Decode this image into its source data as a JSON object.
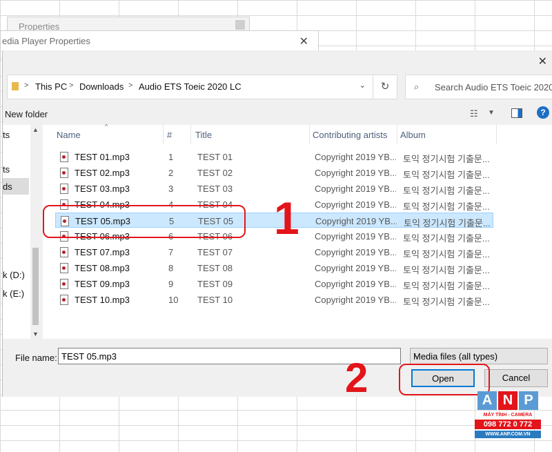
{
  "bg_windows": {
    "properties_title": "Properties",
    "media_title": "edia Player Properties"
  },
  "address": {
    "crumbs": [
      "This PC",
      "Downloads",
      "Audio ETS Toeic 2020 LC"
    ]
  },
  "search": {
    "placeholder": "Search Audio ETS Toeic 2020..."
  },
  "toolbar": {
    "new_folder": "New folder"
  },
  "nav": {
    "items": [
      "ts",
      "ts",
      "ds",
      "k (D:)",
      "k (E:)"
    ]
  },
  "columns": {
    "name": "Name",
    "number": "#",
    "title": "Title",
    "artists": "Contributing artists",
    "album": "Album"
  },
  "files": [
    {
      "name": "TEST 01.mp3",
      "number": "1",
      "title": "TEST 01",
      "artists": "Copyright 2019 YB...",
      "album": "토익 정기시험 기출문..."
    },
    {
      "name": "TEST 02.mp3",
      "number": "2",
      "title": "TEST 02",
      "artists": "Copyright 2019 YB...",
      "album": "토익 정기시험 기출문..."
    },
    {
      "name": "TEST 03.mp3",
      "number": "3",
      "title": "TEST 03",
      "artists": "Copyright 2019 YB...",
      "album": "토익 정기시험 기출문..."
    },
    {
      "name": "TEST 04.mp3",
      "number": "4",
      "title": "TEST 04",
      "artists": "Copyright 2019 YB...",
      "album": "토익 정기시험 기출문..."
    },
    {
      "name": "TEST 05.mp3",
      "number": "5",
      "title": "TEST 05",
      "artists": "Copyright 2019 YB...",
      "album": "토익 정기시험 기출문...",
      "selected": true
    },
    {
      "name": "TEST 06.mp3",
      "number": "6",
      "title": "TEST 06",
      "artists": "Copyright 2019 YB...",
      "album": "토익 정기시험 기출문..."
    },
    {
      "name": "TEST 07.mp3",
      "number": "7",
      "title": "TEST 07",
      "artists": "Copyright 2019 YB...",
      "album": "토익 정기시험 기출문..."
    },
    {
      "name": "TEST 08.mp3",
      "number": "8",
      "title": "TEST 08",
      "artists": "Copyright 2019 YB...",
      "album": "토익 정기시험 기출문..."
    },
    {
      "name": "TEST 09.mp3",
      "number": "9",
      "title": "TEST 09",
      "artists": "Copyright 2019 YB...",
      "album": "토익 정기시험 기출문..."
    },
    {
      "name": "TEST 10.mp3",
      "number": "10",
      "title": "TEST 10",
      "artists": "Copyright 2019 YB...",
      "album": "토익 정기시험 기출문..."
    }
  ],
  "footer": {
    "file_name_label": "File name:",
    "file_name_value": "TEST 05.mp3",
    "filter_value": "Media files (all types)",
    "open_label": "Open",
    "cancel_label": "Cancel"
  },
  "annotations": {
    "step1": "1",
    "step2": "2"
  },
  "watermark": {
    "letters": [
      "A",
      "N",
      "P"
    ],
    "tagline": "MÁY TÍNH - CAMERA",
    "phone": "098 772 0 772",
    "url": "WWW.ANP.COM.VN"
  },
  "colors": {
    "accent": "#0078d7",
    "selection": "#cce8ff",
    "annotation": "#e3141a"
  }
}
